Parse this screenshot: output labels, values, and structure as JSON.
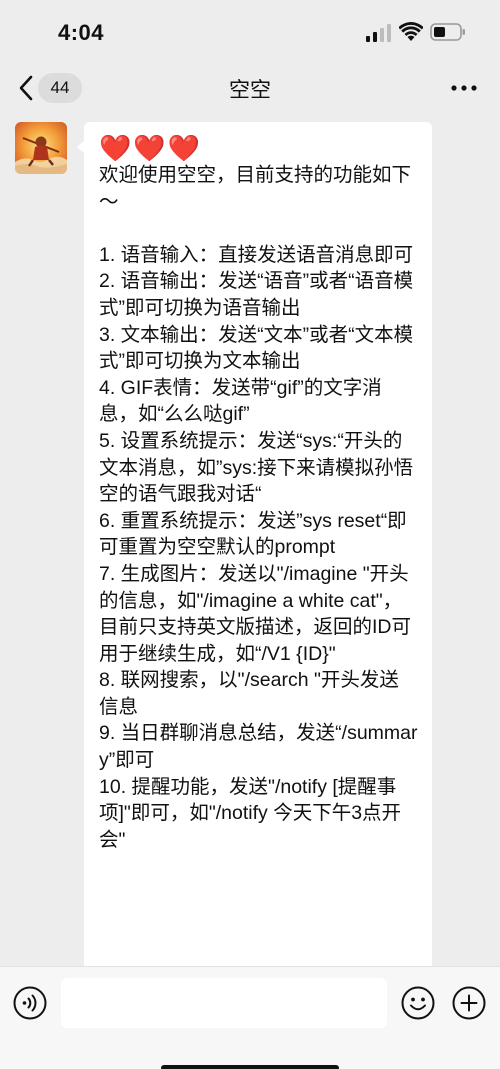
{
  "status_bar": {
    "time": "4:04"
  },
  "nav": {
    "unread_count": "44",
    "title": "空空"
  },
  "message": {
    "hearts": "❤️❤️❤️",
    "text": "欢迎使用空空，目前支持的功能如下～\n\n1. 语音输入：直接发送语音消息即可\n2. 语音输出：发送“语音”或者“语音模式”即可切换为语音输出\n3. 文本输出：发送“文本”或者“文本模式”即可切换为文本输出\n4. GIF表情：发送带“gif”的文字消息，如“么么哒gif”\n5. 设置系统提示：发送“sys:“开头的文本消息，如”sys:接下来请模拟孙悟空的语气跟我对话“\n6. 重置系统提示：发送”sys reset“即可重置为空空默认的prompt\n7. 生成图片：发送以\"/imagine \"开头的信息，如\"/imagine a white cat\"，目前只支持英文版描述，返回的ID可用于继续生成，如“/V1 {ID}\"\n8. 联网搜索，以\"/search \"开头发送信息\n9. 当日群聊消息总结，发送“/summary”即可\n10. 提醒功能，发送\"/notify [提醒事项]\"即可，如\"/notify 今天下午3点开会\""
  },
  "input": {
    "placeholder": ""
  },
  "colors": {
    "background": "#ededed",
    "bubble": "#ffffff",
    "heart": "#e0242b"
  }
}
